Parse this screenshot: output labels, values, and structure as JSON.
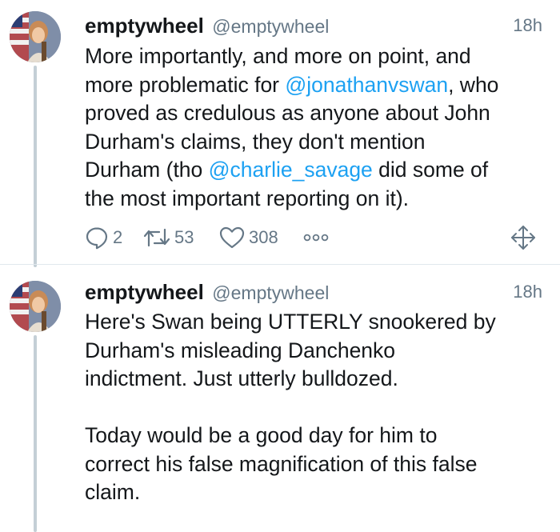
{
  "tweets": [
    {
      "name": "emptywheel",
      "handle": "@emptywheel",
      "time": "18h",
      "text": {
        "p1": "More importantly, and more on point, and\nmore problematic for ",
        "m1": "@jonathanvswan",
        "p2": ", who\nproved as credulous as anyone about John\nDurham's claims, they don't mention\nDurham (tho ",
        "m2": "@charlie_savage",
        "p3": " did some of\nthe most important reporting on it)."
      },
      "actions": {
        "replies": "2",
        "retweets": "53",
        "likes": "308"
      }
    },
    {
      "name": "emptywheel",
      "handle": "@emptywheel",
      "time": "18h",
      "text": "Here's Swan being UTTERLY snookered by\nDurham's misleading Danchenko\nindictment. Just utterly bulldozed.\n\nToday would be a good day for him to\ncorrect his false magnification of this false\nclaim."
    }
  ],
  "icons": [
    "reply-icon",
    "retweet-icon",
    "like-icon",
    "more-icon",
    "move-icon"
  ],
  "colors": {
    "link": "#1da1f2",
    "muted": "#657786",
    "text": "#14171a",
    "thread": "#c4cfd6"
  }
}
